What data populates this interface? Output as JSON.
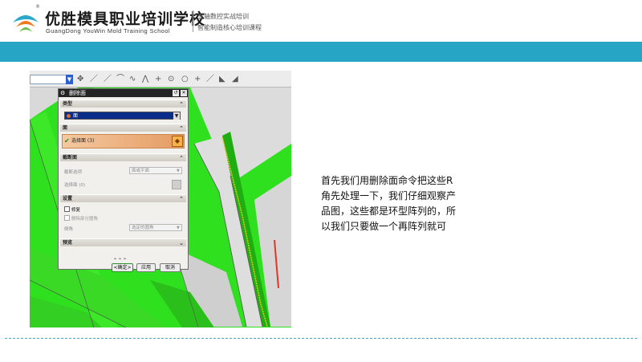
{
  "header": {
    "school_name_cn": "优胜模具职业培训学校",
    "school_name_en": "GuangDong YouWin Mold Training School",
    "registered_mark": "®",
    "slogan_line1": "五轴数控实战培训",
    "slogan_line2": "智能制造核心培训课程"
  },
  "colors": {
    "band": "#27a5c4",
    "cad_green": "#2ee01e",
    "dialog_title_bg": "#242424",
    "selected_row": "#e59a62"
  },
  "dialog": {
    "title": "删除面",
    "sections": {
      "type": "类型",
      "face": "面",
      "cut_face": "截断面",
      "settings": "设置",
      "preview": "预览"
    },
    "type_value": "面",
    "select_face_label": "选择面 (3)",
    "cut_method_label": "截断选项",
    "cut_method_value": "面或平面",
    "select_face_zero_label": "选择面 (0)",
    "repair_label": "修复",
    "delete_partial_round_label": "删除部分圆角",
    "round_label": "倒角",
    "round_value": "选定的圆角",
    "ok_button": "<确定>",
    "apply_button": "应用",
    "cancel_button": "取消"
  },
  "description": [
    "首先我们用删除面命令把这些R",
    "角先处理一下，我们仔细观察产",
    "品图，这些都是环型阵列的，所",
    "以我们只要做一个再阵列就可"
  ],
  "icons": [
    "logo-icon",
    "gear-icon",
    "reset-icon",
    "close-icon",
    "chevron-up-icon",
    "chevron-down-icon",
    "checkmark-icon",
    "select-face-cube-icon"
  ]
}
